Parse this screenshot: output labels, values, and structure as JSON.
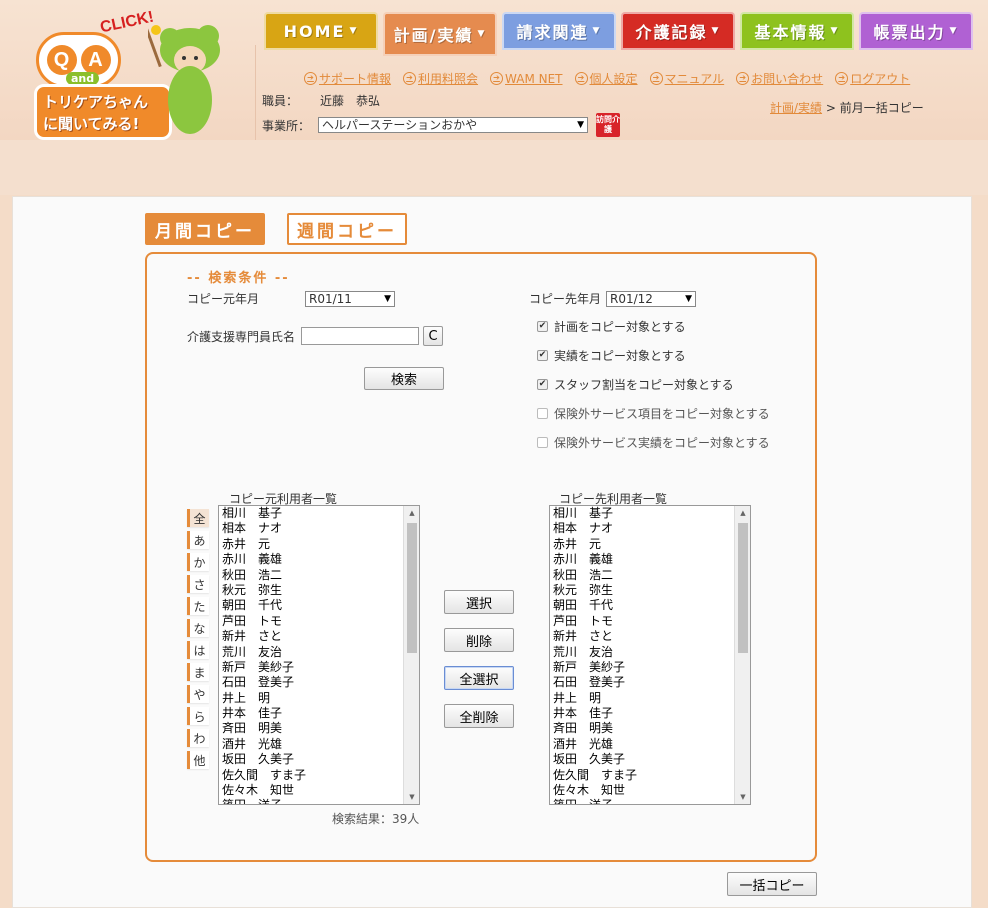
{
  "logo": {
    "qa_q": "Q",
    "qa_a": "A",
    "and": "and",
    "click": "CLICK!",
    "banner_line1": "トリケアちゃん",
    "banner_line2": "に聞いてみる!"
  },
  "nav": {
    "tabs": [
      {
        "label": "HOME",
        "color": "#d8a514"
      },
      {
        "label": "計画/実績",
        "color": "#e58b4f"
      },
      {
        "label": "請求関連",
        "color": "#7d9ee0"
      },
      {
        "label": "介護記録",
        "color": "#d52b24"
      },
      {
        "label": "基本情報",
        "color": "#8ec21e"
      },
      {
        "label": "帳票出力",
        "color": "#b061d3"
      }
    ],
    "active_index": 1
  },
  "header_links": [
    "サポート情報",
    "利用料照会",
    "WAM NET",
    "個人設定",
    "マニュアル",
    "お問い合わせ",
    "ログアウト"
  ],
  "staff": {
    "label": "職員：",
    "name": "近藤　恭弘"
  },
  "office": {
    "label": "事業所：",
    "value": "ヘルパーステーションおかや",
    "badge": "訪問介護"
  },
  "breadcrumb": {
    "link": "計画/実績",
    "separator": ">",
    "current": "前月一括コピー"
  },
  "mode": {
    "monthly": "月間コピー",
    "weekly": "週間コピー"
  },
  "search": {
    "title": "-- 検索条件 --",
    "source_month_label": "コピー元年月",
    "source_month": "R01/11",
    "dest_month_label": "コピー先年月",
    "dest_month": "R01/12",
    "care_manager_label": "介護支援専門員氏名",
    "clear_label": "C",
    "search_button": "検索"
  },
  "checkboxes": [
    {
      "label": "計画をコピー対象とする",
      "checked": true
    },
    {
      "label": "実績をコピー対象とする",
      "checked": true
    },
    {
      "label": "スタッフ割当をコピー対象とする",
      "checked": true
    },
    {
      "label": "保険外サービス項目をコピー対象とする",
      "checked": false
    },
    {
      "label": "保険外サービス実績をコピー対象とする",
      "checked": false
    }
  ],
  "lists": {
    "source_title": "コピー元利用者一覧",
    "dest_title": "コピー先利用者一覧",
    "kana": [
      "全",
      "あ",
      "か",
      "さ",
      "た",
      "な",
      "は",
      "ま",
      "や",
      "ら",
      "わ",
      "他"
    ],
    "source_users": [
      "相川　基子",
      "相本　ナオ",
      "赤井　元",
      "赤川　義雄",
      "秋田　浩二",
      "秋元　弥生",
      "朝田　千代",
      "芦田　トモ",
      "新井　さと",
      "荒川　友治",
      "新戸　美紗子",
      "石田　登美子",
      "井上　明",
      "井本　佳子",
      "斉田　明美",
      "酒井　光雄",
      "坂田　久美子",
      "佐久間　すま子",
      "佐々木　知世",
      "篠田　洋子"
    ],
    "dest_users": [
      "相川　基子",
      "相本　ナオ",
      "赤井　元",
      "赤川　義雄",
      "秋田　浩二",
      "秋元　弥生",
      "朝田　千代",
      "芦田　トモ",
      "新井　さと",
      "荒川　友治",
      "新戸　美紗子",
      "石田　登美子",
      "井上　明",
      "井本　佳子",
      "斉田　明美",
      "酒井　光雄",
      "坂田　久美子",
      "佐久間　すま子",
      "佐々木　知世",
      "篠田　洋子"
    ],
    "result_count": "検索結果：39人"
  },
  "actions": {
    "select": "選択",
    "remove": "削除",
    "select_all": "全選択",
    "remove_all": "全削除",
    "bulk_copy": "一括コピー"
  }
}
